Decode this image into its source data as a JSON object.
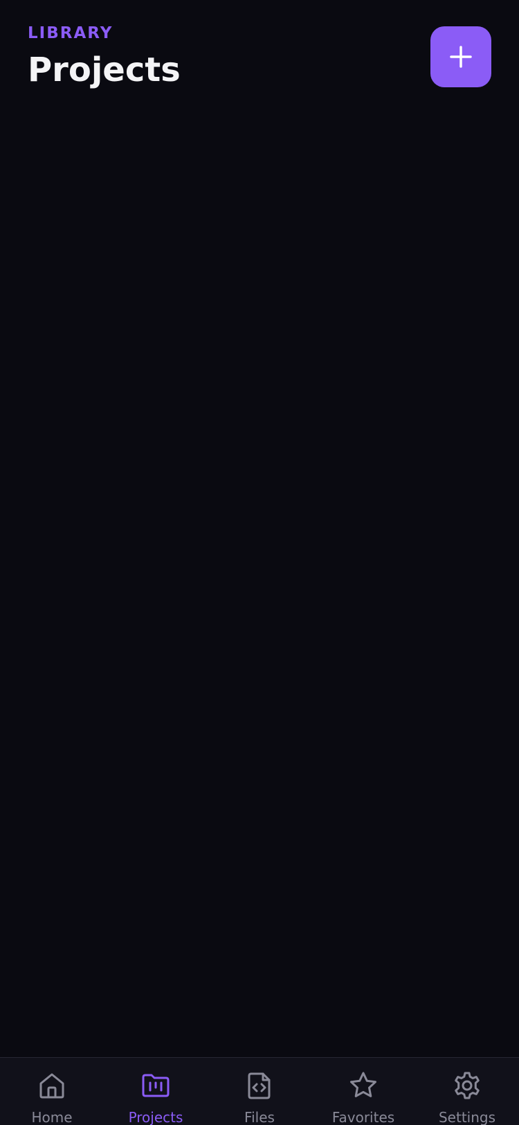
{
  "header": {
    "eyebrow": "LIBRARY",
    "title": "Projects",
    "add_button_icon": "plus-icon"
  },
  "colors": {
    "background": "#0a0a11",
    "accent": "#8b5cf6",
    "title": "#f4f4f6",
    "tab_inactive": "#8a8a98",
    "tabbar_bg": "#11111a"
  },
  "tabbar": {
    "active": "Projects",
    "items": [
      {
        "label": "Home",
        "icon": "home-icon"
      },
      {
        "label": "Projects",
        "icon": "projects-folder-icon"
      },
      {
        "label": "Files",
        "icon": "code-file-icon"
      },
      {
        "label": "Favorites",
        "icon": "star-icon"
      },
      {
        "label": "Settings",
        "icon": "gear-icon"
      }
    ]
  }
}
